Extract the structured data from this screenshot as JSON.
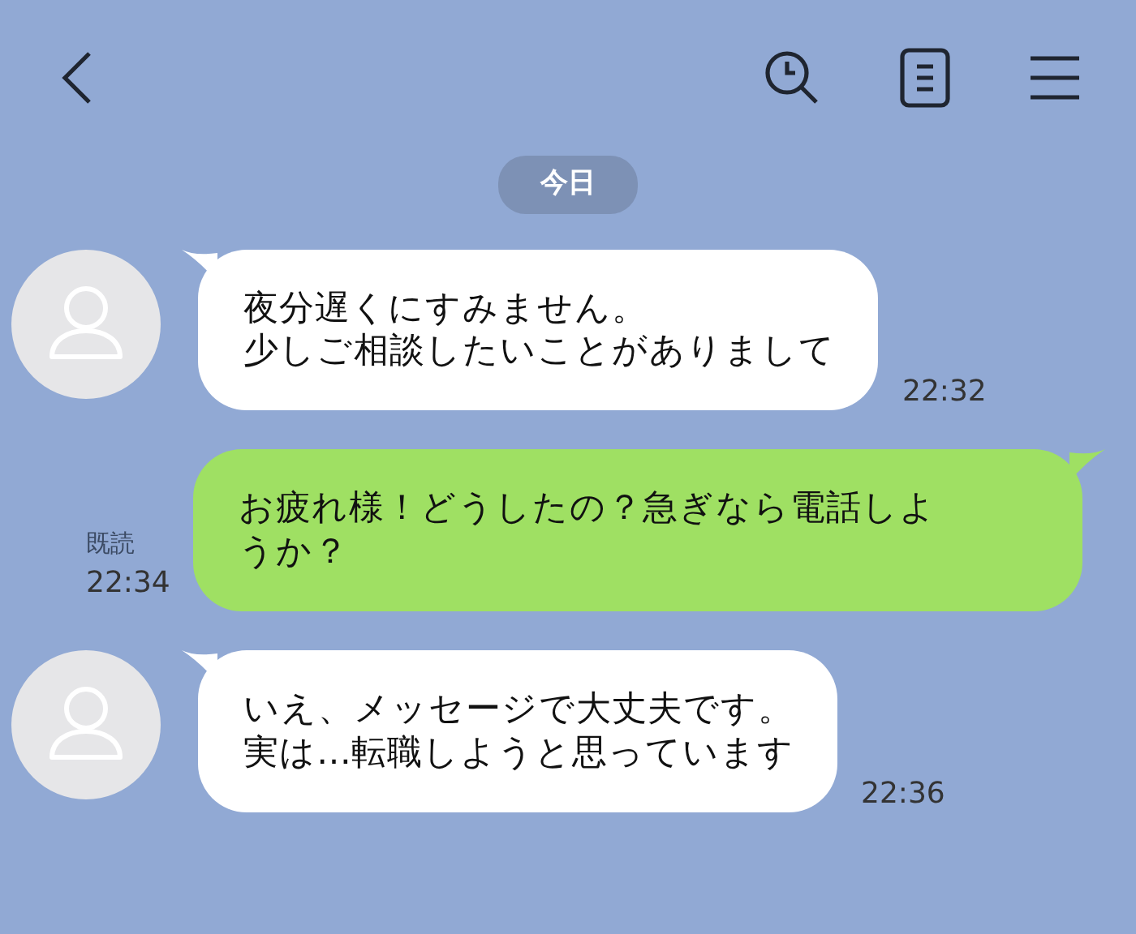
{
  "date_label": "今日",
  "messages": [
    {
      "kind": "received",
      "lines": [
        "夜分遅くにすみません。",
        "少しご相談したいことがありまして"
      ],
      "time": "22:32"
    },
    {
      "kind": "sent",
      "lines": [
        "お疲れ様！どうしたの？急ぎなら電話しよ",
        "うか？"
      ],
      "read_label": "既読",
      "time": "22:34"
    },
    {
      "kind": "received",
      "lines": [
        "いえ、メッセージで大丈夫です。",
        "実は…転職しようと思っています"
      ],
      "time": "22:36"
    }
  ]
}
